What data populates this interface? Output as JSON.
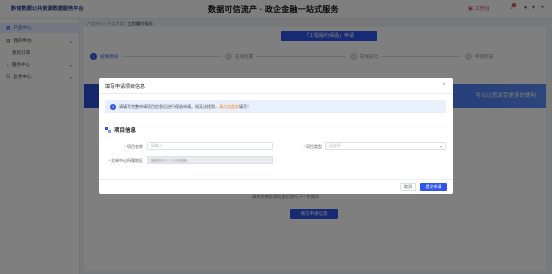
{
  "header": {
    "brand": "黔信数据公共资源数据服务平台",
    "slogan": "数据可信流产 · 政企金融一站式服务",
    "workbench": "工作台",
    "notification_count": "1",
    "accent": "#2f54eb"
  },
  "sidebar": {
    "items": [
      {
        "label": "产品中心",
        "icon": "grid-icon"
      },
      {
        "label": "我的申办",
        "icon": "doc-icon"
      },
      {
        "label": "我的订单",
        "icon": ""
      },
      {
        "label": "服务中心",
        "icon": "bell-icon"
      },
      {
        "label": "业务中心",
        "icon": "users-icon"
      }
    ]
  },
  "breadcrumb": {
    "parent": "产品中心 / 产品方案 / ",
    "current": "工程履约保函"
  },
  "page": {
    "title": "「工程履约保函」申请",
    "steps": [
      {
        "num": "1",
        "label": "投保须知"
      },
      {
        "num": "2",
        "label": "在线签署"
      },
      {
        "num": "3",
        "label": "在线支付"
      },
      {
        "num": "4",
        "label": "申请完成"
      }
    ],
    "banner_text": "可以让您享受更多的便利"
  },
  "background": {
    "hint": "请先完善投保信息后进行下一步操作",
    "fill_button": "填写申请信息"
  },
  "modal": {
    "title": "填写申请项目信息",
    "close": "×",
    "notice_prefix": "请填写完整申请项目信息后进行保函申请，如无法找到，",
    "notice_link": "请点击此处",
    "notice_suffix": "填写！",
    "section_title": "项目信息",
    "fields": {
      "project_name": {
        "label": "项目名称",
        "placeholder": "请输入"
      },
      "project_type": {
        "label": "项目类型",
        "placeholder": "请选择"
      },
      "trading_center": {
        "label": "交易中心所属地区",
        "value": ""
      }
    },
    "cancel": "取消",
    "next": "提交申请"
  }
}
